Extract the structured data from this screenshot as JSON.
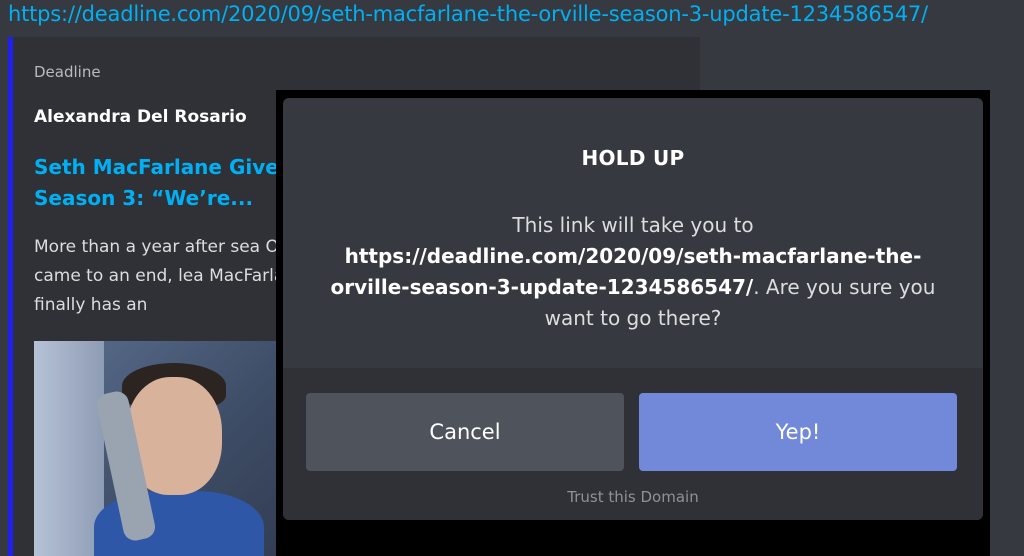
{
  "message": {
    "link_text": "https://deadline.com/2020/09/seth-macfarlane-the-orville-season-3-update-1234586547/"
  },
  "embed": {
    "provider": "Deadline",
    "author": "Alexandra Del Rosario",
    "title": "Seth MacFarlane Give Season 3: “We’re...",
    "description": "More than a year after sea Orville came to an end, lea MacFarlane finally has an",
    "accent_color": "#1f1ff0"
  },
  "modal": {
    "title": "HOLD UP",
    "text_prefix": "This link will take you to",
    "url": "https://deadline.com/2020/09/seth-macfarlane-the-orville-season-3-update-1234586547/",
    "text_suffix": ". Are you sure you want to go there?",
    "cancel_label": "Cancel",
    "confirm_label": "Yep!",
    "trust_label": "Trust this Domain",
    "confirm_color": "#7289da",
    "cancel_color": "#4f545c"
  }
}
